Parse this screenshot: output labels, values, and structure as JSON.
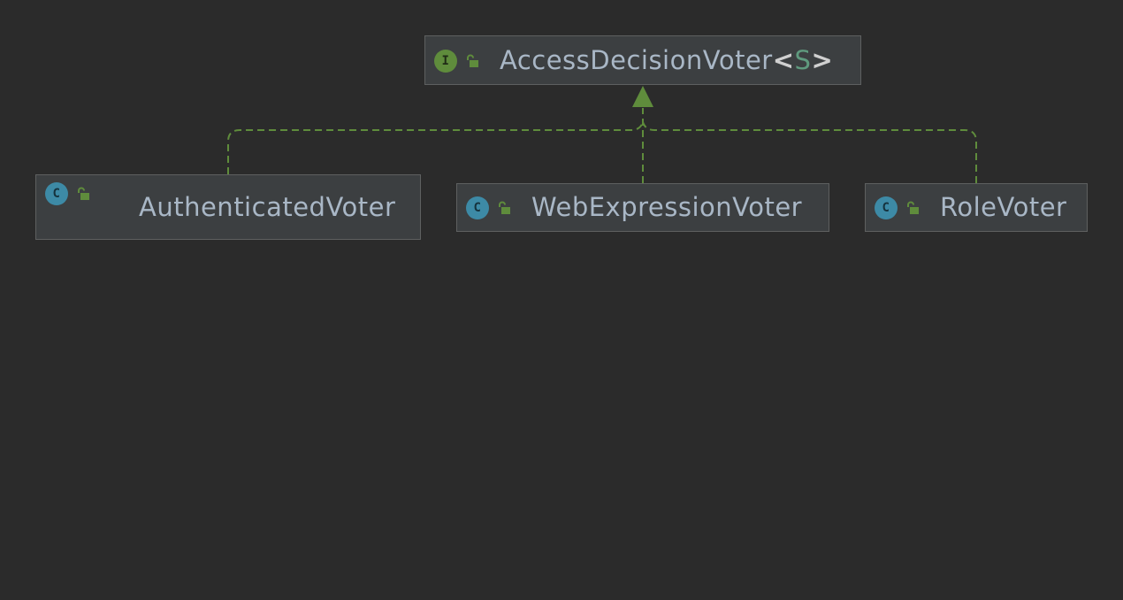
{
  "diagram": {
    "interface": {
      "badge": "I",
      "name": "AccessDecisionVoter",
      "type_open": "<",
      "type_param": "S",
      "type_close": ">",
      "icon": "interface-icon",
      "visibility_icon": "public-lock-icon"
    },
    "classes": [
      {
        "badge": "C",
        "name": "AuthenticatedVoter",
        "icon": "class-icon",
        "visibility_icon": "public-lock-icon"
      },
      {
        "badge": "C",
        "name": "WebExpressionVoter",
        "icon": "class-icon",
        "visibility_icon": "public-lock-icon"
      },
      {
        "badge": "C",
        "name": "RoleVoter",
        "icon": "class-icon",
        "visibility_icon": "public-lock-icon"
      }
    ],
    "relationship": "implements",
    "colors": {
      "background": "#2b2b2b",
      "node_fill": "#3c3f41",
      "node_border": "#5e6060",
      "text": "#a9b7c6",
      "edge": "#5f8c3c",
      "interface_badge": "#5f8c3c",
      "class_badge": "#3d8aa6"
    }
  }
}
